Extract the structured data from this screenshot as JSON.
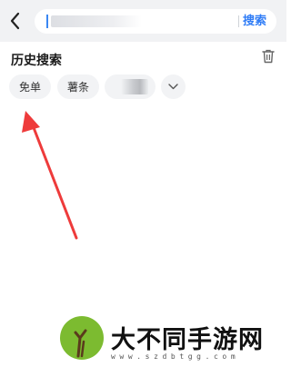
{
  "header": {
    "search_button_label": "搜索",
    "search_placeholder": ""
  },
  "history": {
    "title": "历史搜索",
    "chips": [
      {
        "label": "免单"
      },
      {
        "label": "薯条"
      },
      {
        "label": ""
      }
    ]
  },
  "icons": {
    "back": "back-arrow-icon",
    "delete": "trash-icon",
    "expand": "chevron-down-icon"
  },
  "watermark": {
    "title": "大不同手游网",
    "url": "www.szdbtgg.com"
  },
  "colors": {
    "accent": "#2f7cf6",
    "arrow": "#ee3b3b",
    "logo": "#7cbb30"
  }
}
